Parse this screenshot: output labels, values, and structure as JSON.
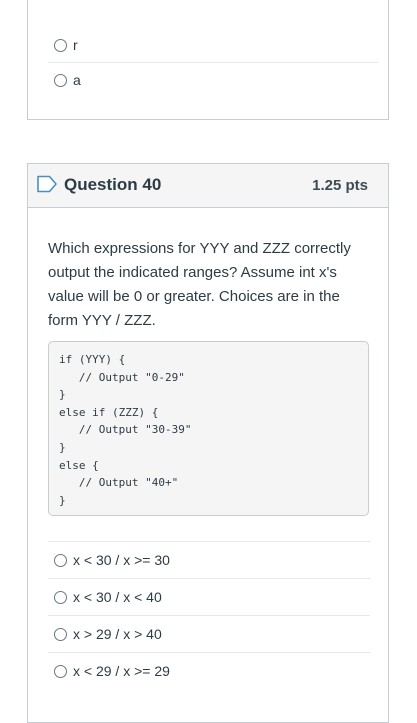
{
  "previous_question": {
    "answers": [
      {
        "label": "r"
      },
      {
        "label": "a"
      }
    ]
  },
  "question": {
    "title": "Question 40",
    "points": "1.25 pts",
    "text": "Which expressions for YYY and ZZZ correctly output the indicated ranges? Assume int x's value will be 0 or greater. Choices are in the form YYY / ZZZ.",
    "code": "if (YYY) {\n   // Output \"0-29\"\n}\nelse if (ZZZ) {\n   // Output \"30-39\"\n}\nelse {\n   // Output \"40+\"\n}",
    "answers": [
      {
        "label": "x < 30 / x >= 30"
      },
      {
        "label": "x < 30 / x < 40"
      },
      {
        "label": "x > 29 / x > 40"
      },
      {
        "label": "x < 29 / x >= 29"
      }
    ]
  }
}
